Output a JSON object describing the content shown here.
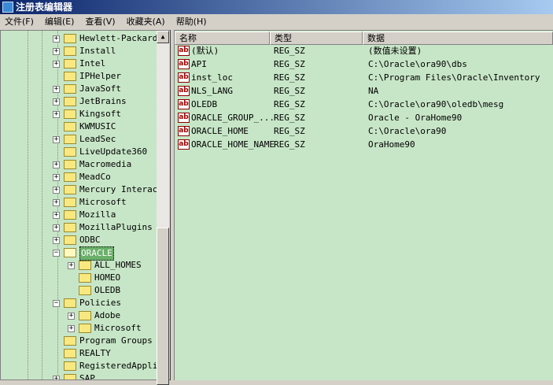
{
  "window": {
    "title": "注册表编辑器",
    "icon": "regedit-icon"
  },
  "menu": [
    "文件(F)",
    "编辑(E)",
    "查看(V)",
    "收藏夹(A)",
    "帮助(H)"
  ],
  "tree": [
    {
      "label": "Hewlett-Packard",
      "level": 1,
      "expander": "plus"
    },
    {
      "label": "Install",
      "level": 1,
      "expander": "plus"
    },
    {
      "label": "Intel",
      "level": 1,
      "expander": "plus"
    },
    {
      "label": "IPHelper",
      "level": 1,
      "expander": ""
    },
    {
      "label": "JavaSoft",
      "level": 1,
      "expander": "plus"
    },
    {
      "label": "JetBrains",
      "level": 1,
      "expander": "plus"
    },
    {
      "label": "Kingsoft",
      "level": 1,
      "expander": "plus"
    },
    {
      "label": "KWMUSIC",
      "level": 1,
      "expander": ""
    },
    {
      "label": "LeadSec",
      "level": 1,
      "expander": "plus"
    },
    {
      "label": "LiveUpdate360",
      "level": 1,
      "expander": ""
    },
    {
      "label": "Macromedia",
      "level": 1,
      "expander": "plus"
    },
    {
      "label": "MeadCo",
      "level": 1,
      "expander": "plus"
    },
    {
      "label": "Mercury Interact",
      "level": 1,
      "expander": "plus"
    },
    {
      "label": "Microsoft",
      "level": 1,
      "expander": "plus"
    },
    {
      "label": "Mozilla",
      "level": 1,
      "expander": "plus"
    },
    {
      "label": "MozillaPlugins",
      "level": 1,
      "expander": "plus"
    },
    {
      "label": "ODBC",
      "level": 1,
      "expander": "plus"
    },
    {
      "label": "ORACLE",
      "level": 1,
      "expander": "minus",
      "selected": true
    },
    {
      "label": "ALL_HOMES",
      "level": 2,
      "expander": "plus"
    },
    {
      "label": "HOMEO",
      "level": 2,
      "expander": ""
    },
    {
      "label": "OLEDB",
      "level": 2,
      "expander": ""
    },
    {
      "label": "Policies",
      "level": 1,
      "expander": "minus"
    },
    {
      "label": "Adobe",
      "level": 2,
      "expander": "plus"
    },
    {
      "label": "Microsoft",
      "level": 2,
      "expander": "plus"
    },
    {
      "label": "Program Groups",
      "level": 1,
      "expander": ""
    },
    {
      "label": "REALTY",
      "level": 1,
      "expander": ""
    },
    {
      "label": "RegisteredApplic",
      "level": 1,
      "expander": ""
    },
    {
      "label": "SAP",
      "level": 1,
      "expander": "plus"
    }
  ],
  "list": {
    "columns": [
      "名称",
      "类型",
      "数据"
    ],
    "rows": [
      {
        "name": "(默认)",
        "type": "REG_SZ",
        "data": "(数值未设置)"
      },
      {
        "name": "API",
        "type": "REG_SZ",
        "data": "C:\\Oracle\\ora90\\dbs"
      },
      {
        "name": "inst_loc",
        "type": "REG_SZ",
        "data": "C:\\Program Files\\Oracle\\Inventory"
      },
      {
        "name": "NLS_LANG",
        "type": "REG_SZ",
        "data": "NA"
      },
      {
        "name": "OLEDB",
        "type": "REG_SZ",
        "data": "C:\\Oracle\\ora90\\oledb\\mesg"
      },
      {
        "name": "ORACLE_GROUP_...",
        "type": "REG_SZ",
        "data": "Oracle - OraHome90"
      },
      {
        "name": "ORACLE_HOME",
        "type": "REG_SZ",
        "data": "C:\\Oracle\\ora90"
      },
      {
        "name": "ORACLE_HOME_NAME",
        "type": "REG_SZ",
        "data": "OraHome90"
      }
    ],
    "icon_text": "ab"
  },
  "colors": {
    "background": "#c7e6c7",
    "titlebar": "#0a246a"
  }
}
